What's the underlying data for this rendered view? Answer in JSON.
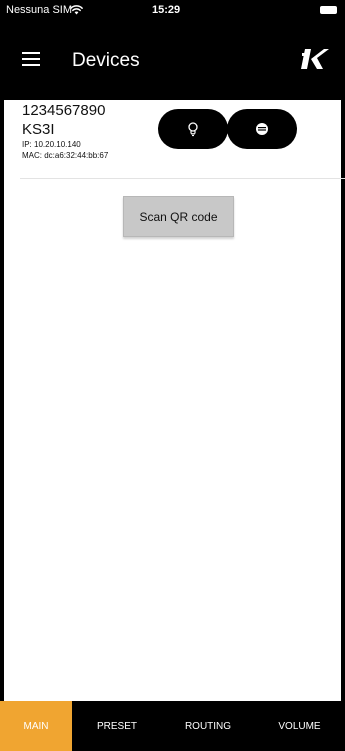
{
  "status_bar": {
    "carrier": "Nessuna SIM",
    "wifi_icon": "wifi-icon",
    "time": "15:29",
    "battery_icon": "battery-icon"
  },
  "toolbar": {
    "title": "Devices",
    "menu_icon": "hamburger-menu-icon",
    "logo": "K"
  },
  "device": {
    "serial": "1234567890",
    "model": "KS3I",
    "ip": "IP: 10.20.10.140",
    "mac": "MAC: dc:a6:32:44:bb:67",
    "buttons": [
      {
        "icon": "lightbulb-icon"
      },
      {
        "icon": "info-icon"
      }
    ]
  },
  "scan_button": {
    "label": "Scan QR code"
  },
  "bottom_nav": {
    "tabs": [
      {
        "label": "MAIN",
        "active": true
      },
      {
        "label": "PRESET",
        "active": false
      },
      {
        "label": "ROUTING",
        "active": false
      },
      {
        "label": "VOLUME",
        "active": false
      }
    ],
    "accent": "#f0a531"
  }
}
